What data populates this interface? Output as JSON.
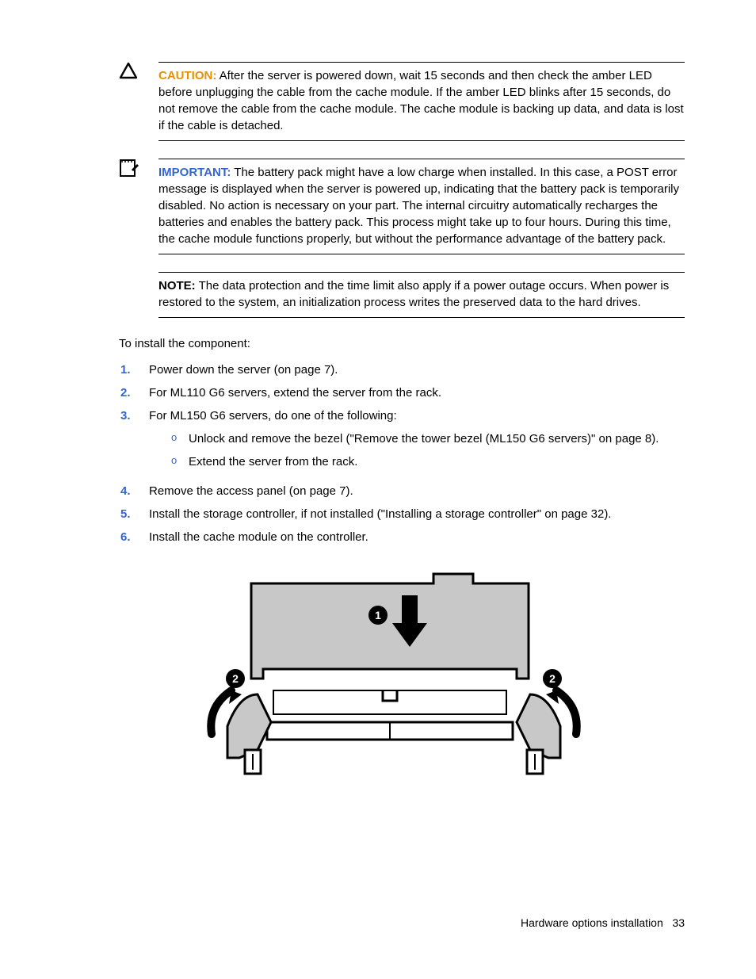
{
  "callouts": {
    "caution": {
      "label": "CAUTION:",
      "text": "  After the server is powered down, wait 15 seconds and then check the amber LED before unplugging the cable from the cache module. If the amber LED blinks after 15 seconds, do not remove the cable from the cache module. The cache module is backing up data, and data is lost if the cable is detached."
    },
    "important": {
      "label": "IMPORTANT:",
      "text": "  The battery pack might have a low charge when installed. In this case, a POST error message is displayed when the server is powered up, indicating that the battery pack is temporarily disabled. No action is necessary on your part. The internal circuitry automatically recharges the batteries and enables the battery pack. This process might take up to four hours. During this time, the cache module functions properly, but without the performance advantage of the battery pack."
    },
    "note": {
      "label": "NOTE:",
      "text": "  The data protection and the time limit also apply if a power outage occurs. When power is restored to the system, an initialization process writes the preserved data to the hard drives."
    }
  },
  "intro": "To install the component:",
  "steps": [
    {
      "num": "1.",
      "text": "Power down the server (on page 7)."
    },
    {
      "num": "2.",
      "text": "For ML110 G6 servers, extend the server from the rack."
    },
    {
      "num": "3.",
      "text": "For ML150 G6 servers, do one of the following:",
      "sub": [
        "Unlock and remove the bezel (\"Remove the tower bezel (ML150 G6 servers)\" on page 8).",
        "Extend the server from the rack."
      ]
    },
    {
      "num": "4.",
      "text": "Remove the access panel (on page 7)."
    },
    {
      "num": "5.",
      "text": "Install the storage controller, if not installed (\"Installing a storage controller\" on page 32)."
    },
    {
      "num": "6.",
      "text": "Install the cache module on the controller."
    }
  ],
  "footer": {
    "section": "Hardware options installation",
    "page": "33"
  }
}
